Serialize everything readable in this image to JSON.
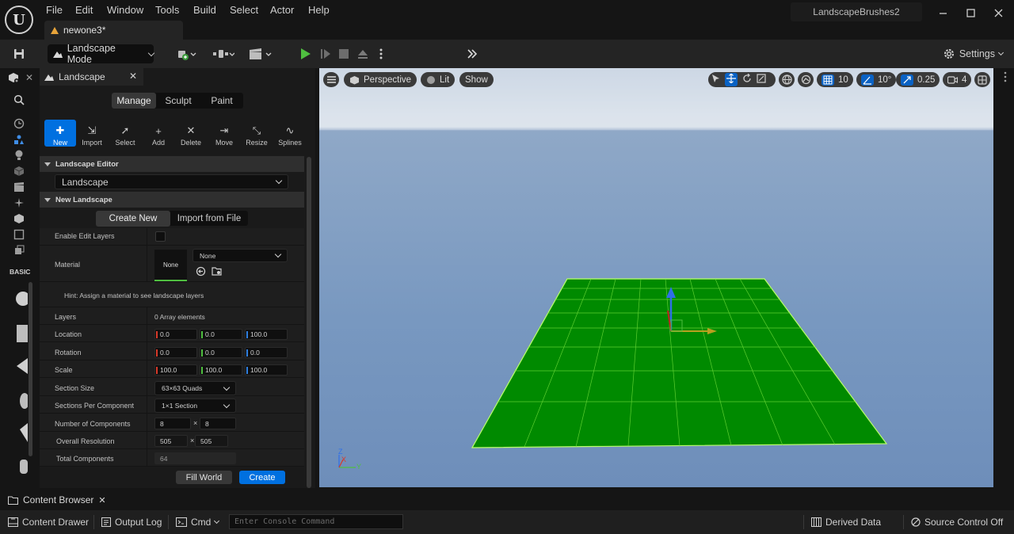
{
  "app": {
    "logo_text": "U",
    "project_title": "LandscapeBrushes2",
    "document_tab": "newone3*"
  },
  "menu": [
    "File",
    "Edit",
    "Window",
    "Tools",
    "Build",
    "Select",
    "Actor",
    "Help"
  ],
  "toolbar": {
    "mode": "Landscape Mode",
    "settings": "Settings"
  },
  "left_strip": {
    "basic_label": "BASIC"
  },
  "panel": {
    "tab_title": "Landscape",
    "mode_tabs": [
      "Manage",
      "Sculpt",
      "Paint"
    ],
    "tools": [
      "New",
      "Import",
      "Select",
      "Add",
      "Delete",
      "Move",
      "Resize",
      "Splines"
    ],
    "editor_section": "Landscape Editor",
    "editor_value": "Landscape",
    "new_section": "New Landscape",
    "create_new": "Create New",
    "import_from_file": "Import from File",
    "enable_edit_layers": "Enable Edit Layers",
    "material_label": "Material",
    "material_thumb": "None",
    "material_value": "None",
    "hint": "Hint: Assign a material to see landscape layers",
    "layers_label": "Layers",
    "layers_value": "0 Array elements",
    "location_label": "Location",
    "location": [
      "0.0",
      "0.0",
      "100.0"
    ],
    "rotation_label": "Rotation",
    "rotation": [
      "0.0",
      "0.0",
      "0.0"
    ],
    "scale_label": "Scale",
    "scale": [
      "100.0",
      "100.0",
      "100.0"
    ],
    "section_size_label": "Section Size",
    "section_size": "63×63 Quads",
    "sections_per_component_label": "Sections Per Component",
    "sections_per_component": "1×1 Section",
    "num_components_label": "Number of Components",
    "num_components": [
      "8",
      "8"
    ],
    "overall_resolution_label": "Overall Resolution",
    "overall_resolution": [
      "505",
      "505"
    ],
    "total_components_label": "Total Components",
    "total_components": "64",
    "times": "×",
    "fill_world": "Fill World",
    "create": "Create"
  },
  "viewport": {
    "perspective": "Perspective",
    "lit": "Lit",
    "show": "Show",
    "grid_snap": "10",
    "rotation_snap": "10°",
    "scale_snap": "0.25",
    "camera_speed": "4",
    "axis_z": "Z",
    "axis_x": "X",
    "axis_y": "Y"
  },
  "bottom": {
    "content_browser_tab": "Content Browser",
    "content_drawer": "Content Drawer",
    "output_log": "Output Log",
    "cmd": "Cmd",
    "console_placeholder": "Enter Console Command",
    "derived_data": "Derived Data",
    "source_control": "Source Control Off"
  },
  "colors": {
    "accent_blue": "#0070e0",
    "landscape_green": "#008a00",
    "grid_line": "#b9ff6a"
  }
}
